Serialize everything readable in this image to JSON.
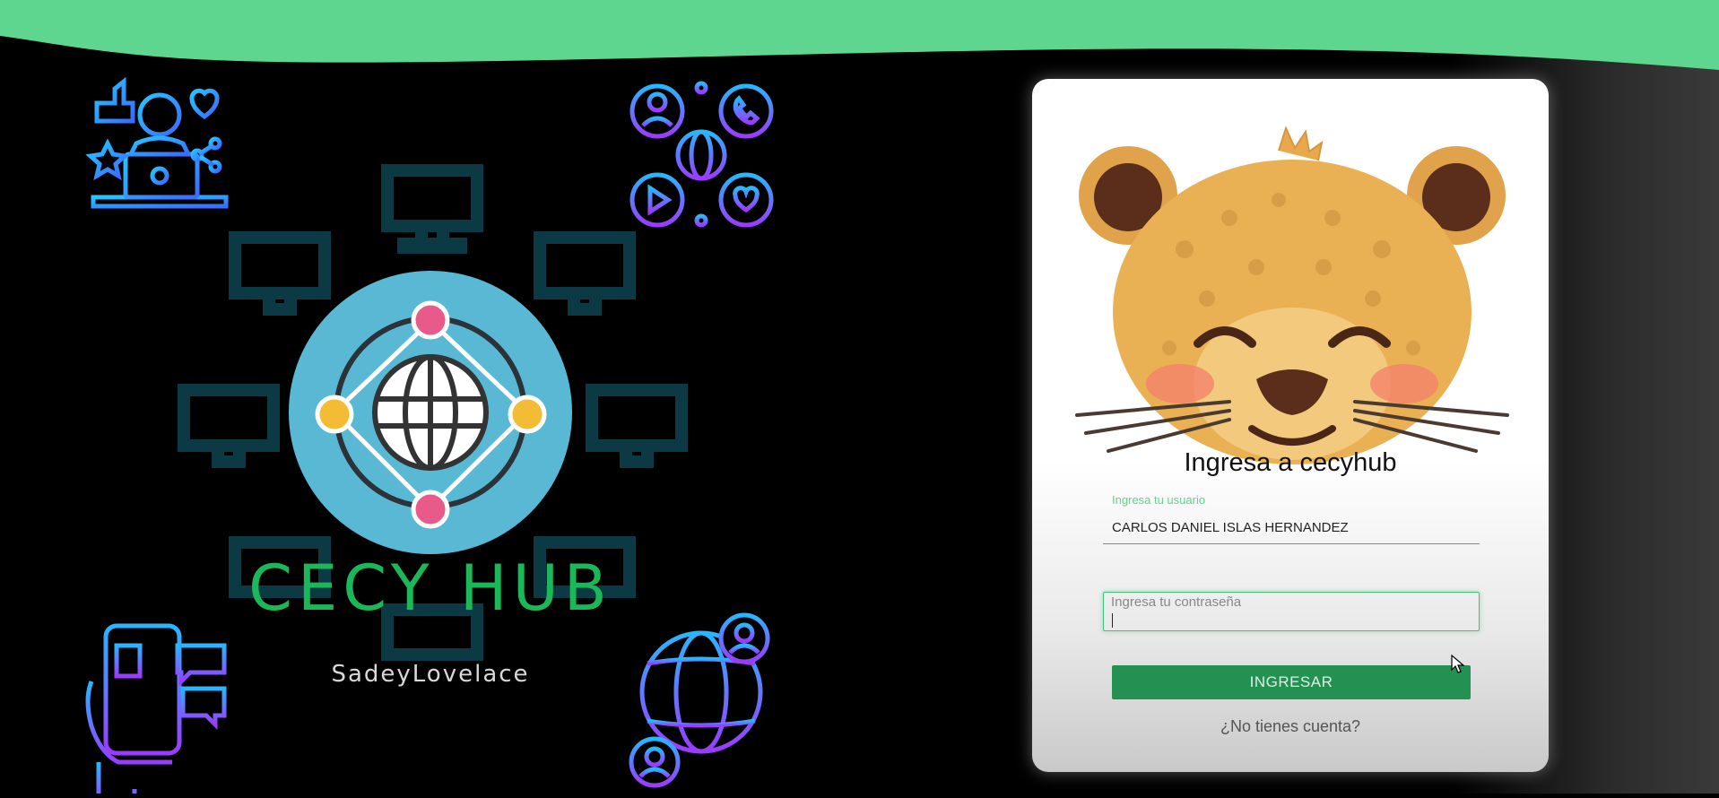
{
  "brand": {
    "title": "CECY HUB",
    "subtitle": "SadeyLovelace",
    "accent": "#1bb85a",
    "wave_color": "#5ed68f"
  },
  "icons": [
    "remote-worker-icon",
    "network-contacts-icon",
    "mobile-chat-icon",
    "global-community-icon",
    "computer-network-icon",
    "globe-icon"
  ],
  "login": {
    "title": "Ingresa a cecyhub",
    "username_label": "Ingresa tu usuario",
    "username_value": "CARLOS DANIEL ISLAS HERNANDEZ",
    "password_label": "Ingresa tu contraseña",
    "password_value": "",
    "submit_label": "INGRESAR",
    "signup_link": "¿No tienes cuenta?",
    "button_color": "#239152",
    "mascot": "cheetah-mascot"
  }
}
